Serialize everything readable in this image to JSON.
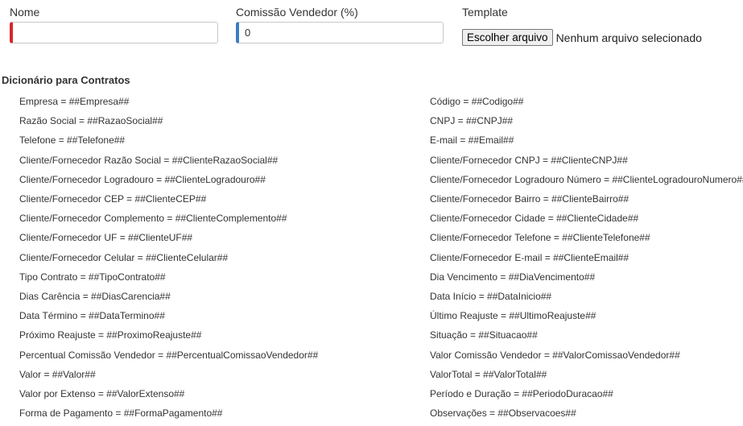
{
  "form": {
    "nome_label": "Nome",
    "nome_value": "",
    "comissao_label": "Comissão Vendedor (%)",
    "comissao_value": "0",
    "template_label": "Template",
    "file_button_label": "Escolher arquivo",
    "file_status": "Nenhum arquivo selecionado"
  },
  "dictionary": {
    "title": "Dicionário para Contratos",
    "left": [
      "Empresa = ##Empresa##",
      "Razão Social = ##RazaoSocial##",
      "Telefone = ##Telefone##",
      "Cliente/Fornecedor Razão Social = ##ClienteRazaoSocial##",
      "Cliente/Fornecedor Logradouro = ##ClienteLogradouro##",
      "Cliente/Fornecedor CEP = ##ClienteCEP##",
      "Cliente/Fornecedor Complemento = ##ClienteComplemento##",
      "Cliente/Fornecedor UF = ##ClienteUF##",
      "Cliente/Fornecedor Celular = ##ClienteCelular##",
      "Tipo Contrato = ##TipoContrato##",
      "Dias Carência = ##DiasCarencia##",
      "Data Término = ##DataTermino##",
      "Próximo Reajuste = ##ProximoReajuste##",
      "Percentual Comissão Vendedor = ##PercentualComissaoVendedor##",
      "Valor = ##Valor##",
      "Valor por Extenso = ##ValorExtenso##",
      "Forma de Pagamento = ##FormaPagamento##"
    ],
    "right": [
      "Código = ##Codigo##",
      "CNPJ = ##CNPJ##",
      "E-mail = ##Email##",
      "Cliente/Fornecedor CNPJ = ##ClienteCNPJ##",
      "Cliente/Fornecedor Logradouro Número = ##ClienteLogradouroNumero##",
      "Cliente/Fornecedor Bairro = ##ClienteBairro##",
      "Cliente/Fornecedor Cidade = ##ClienteCidade##",
      "Cliente/Fornecedor Telefone = ##ClienteTelefone##",
      "Cliente/Fornecedor E-mail = ##ClienteEmail##",
      "Dia Vencimento = ##DiaVencimento##",
      "Data Início = ##DataInicio##",
      "Último Reajuste = ##UltimoReajuste##",
      "Situação = ##Situacao##",
      "Valor Comissão Vendedor = ##ValorComissaoVendedor##",
      "ValorTotal = ##ValorTotal##",
      "Período e Duração = ##PeriodoDuracao##",
      "Observações = ##Observacoes##"
    ]
  }
}
